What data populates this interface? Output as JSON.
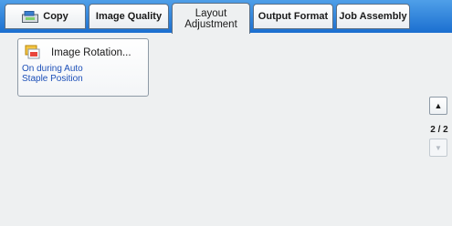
{
  "tabs": [
    {
      "label": "Copy",
      "icon": "copy-icon"
    },
    {
      "label": "Image Quality"
    },
    {
      "label": "Layout\nAdjustment",
      "active": true
    },
    {
      "label": "Output Format"
    },
    {
      "label": "Job Assembly"
    }
  ],
  "feature": {
    "title": "Image Rotation...",
    "value": "On during Auto\nStaple Position",
    "icon": "image-rotation-icon"
  },
  "pager": {
    "up_symbol": "▲",
    "down_symbol": "▼",
    "indicator": "2 / 2"
  },
  "colors": {
    "tabbar": "#2f86dd",
    "panel": "#eef0f1",
    "value_text": "#1c4fb8"
  }
}
